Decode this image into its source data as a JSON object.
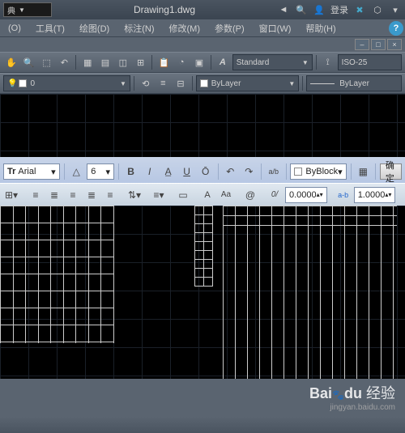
{
  "titlebar": {
    "combo": "典",
    "filename": "Drawing1.dwg",
    "login": "登录"
  },
  "menu": {
    "items": [
      "(O)",
      "工具(T)",
      "绘图(D)",
      "标注(N)",
      "修改(M)",
      "参数(P)",
      "窗口(W)",
      "帮助(H)"
    ]
  },
  "toolbar2": {
    "style": "Standard",
    "dimstyle": "ISO-25"
  },
  "toolbar3": {
    "layer": "0",
    "color": "ByLayer",
    "line": "ByLayer"
  },
  "textbar": {
    "font": "Arial",
    "size": "6",
    "block": "ByBlock",
    "confirm": "确定"
  },
  "textbar2": {
    "tracking": "0.0000",
    "width1": "1.0000",
    "width2": "1.",
    "a_label": "A",
    "aa_label": "Aa",
    "at": "@",
    "slash": "0/",
    "ab": "a-b"
  },
  "watermark": {
    "bai": "Bai",
    "du": "du",
    "exp": "经验",
    "url": "jingyan.baidu.com"
  }
}
